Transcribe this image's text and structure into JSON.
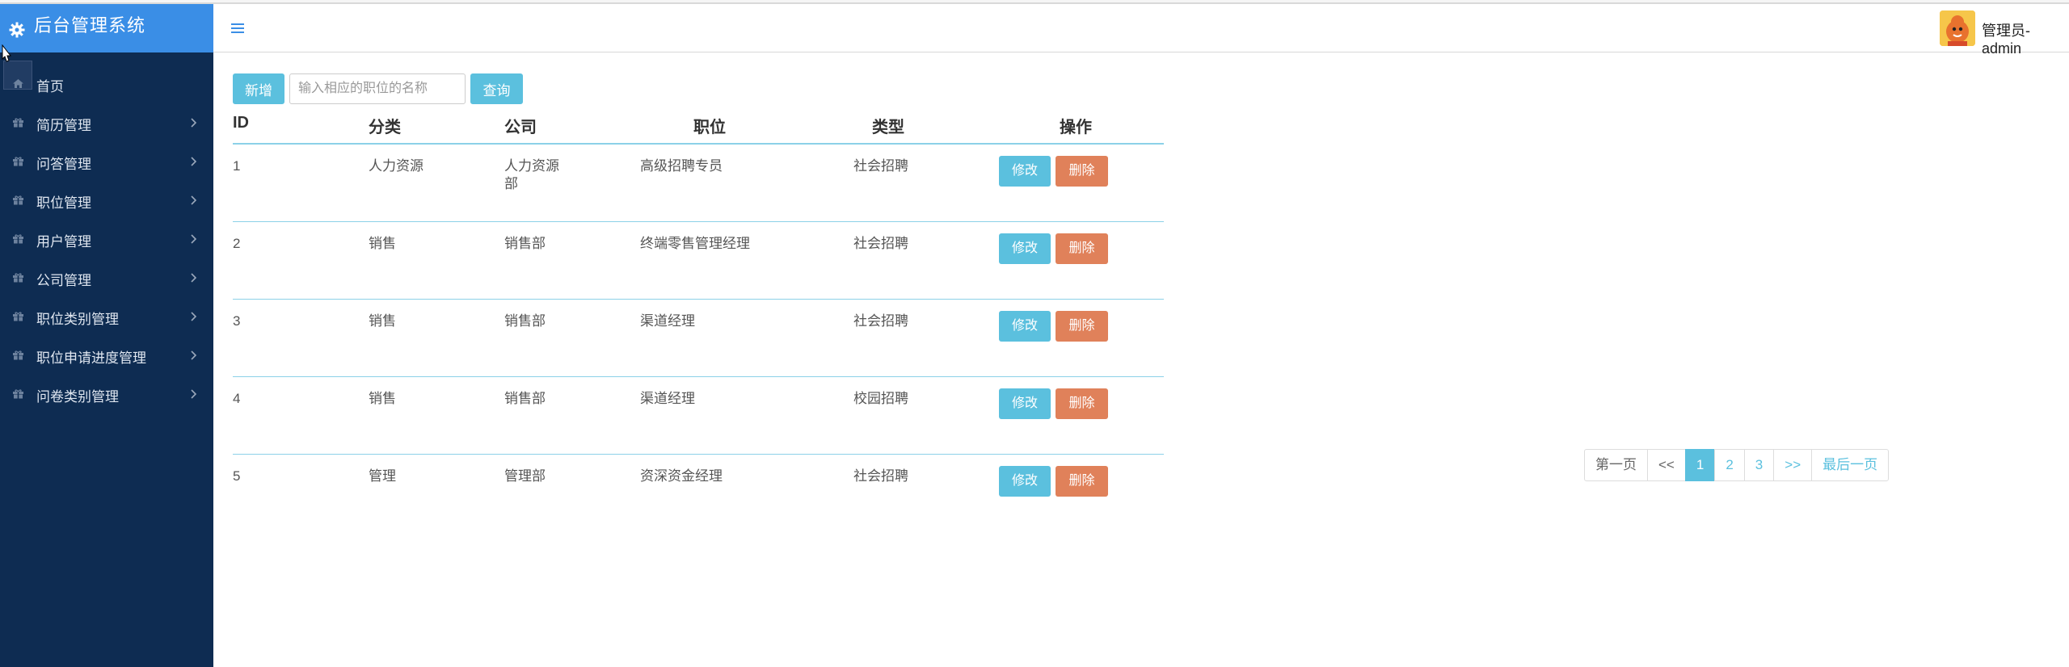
{
  "app": {
    "title": "后台管理系统"
  },
  "sidebar": {
    "items": [
      {
        "label": "首页",
        "icon": "home-icon",
        "has_arrow": false
      },
      {
        "label": "简历管理",
        "icon": "gift-icon",
        "has_arrow": true
      },
      {
        "label": "问答管理",
        "icon": "gift-icon",
        "has_arrow": true
      },
      {
        "label": "职位管理",
        "icon": "gift-icon",
        "has_arrow": true
      },
      {
        "label": "用户管理",
        "icon": "gift-icon",
        "has_arrow": true
      },
      {
        "label": "公司管理",
        "icon": "gift-icon",
        "has_arrow": true
      },
      {
        "label": "职位类别管理",
        "icon": "gift-icon",
        "has_arrow": true
      },
      {
        "label": "职位申请进度管理",
        "icon": "gift-icon",
        "has_arrow": true
      },
      {
        "label": "问卷类别管理",
        "icon": "gift-icon",
        "has_arrow": true
      }
    ]
  },
  "header": {
    "user_name": "管理员-admin"
  },
  "toolbar": {
    "add_label": "新增",
    "search_placeholder": "输入相应的职位的名称",
    "search_value": "",
    "query_label": "查询"
  },
  "table": {
    "headers": [
      "ID",
      "分类",
      "公司",
      "职位",
      "类型",
      "操作"
    ],
    "rows": [
      {
        "id": "1",
        "category": "人力资源",
        "company": "人力资源部",
        "position": "高级招聘专员",
        "type": "社会招聘"
      },
      {
        "id": "2",
        "category": "销售",
        "company": "销售部",
        "position": "终端零售管理经理",
        "type": "社会招聘"
      },
      {
        "id": "3",
        "category": "销售",
        "company": "销售部",
        "position": "渠道经理",
        "type": "社会招聘"
      },
      {
        "id": "4",
        "category": "销售",
        "company": "销售部",
        "position": "渠道经理",
        "type": "校园招聘"
      },
      {
        "id": "5",
        "category": "管理",
        "company": "管理部",
        "position": "资深资金经理",
        "type": "社会招聘"
      }
    ],
    "edit_label": "修改",
    "delete_label": "删除"
  },
  "pagination": {
    "first": "第一页",
    "prev": "<<",
    "pages": [
      "1",
      "2",
      "3"
    ],
    "active_page": "1",
    "next": ">>",
    "last": "最后一页"
  },
  "colors": {
    "sidebar_bg": "#0e2c52",
    "brand_bg": "#3a8ee6",
    "info": "#5bc0de",
    "danger": "#e0815a"
  }
}
